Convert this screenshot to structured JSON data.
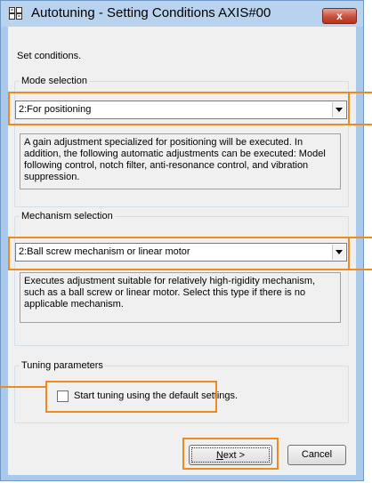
{
  "window": {
    "title": "Autotuning - Setting Conditions AXIS#00",
    "close_label": "x"
  },
  "instruction": "Set conditions.",
  "mode": {
    "legend": "Mode selection",
    "selected": "2:For positioning",
    "description": "A gain adjustment specialized for positioning will be executed. In addition, the following automatic adjustments can be executed: Model following control, notch filter, anti-resonance control, and vibration suppression."
  },
  "mechanism": {
    "legend": "Mechanism selection",
    "selected": "2:Ball screw mechanism or linear motor",
    "description": "Executes adjustment suitable for relatively high-rigidity mechanism, such as a ball screw or linear motor. Select this type if there is no applicable mechanism."
  },
  "tuning": {
    "legend": "Tuning parameters",
    "checkbox_label": "Start tuning using the default settings.",
    "checked": false
  },
  "buttons": {
    "next_prefix": "N",
    "next_rest": "ext >",
    "cancel": "Cancel"
  },
  "colors": {
    "highlight": "#ee8a1f",
    "window_frame": "#a9c8ea",
    "close_button": "#c7503c"
  },
  "icons": {
    "app": "axis-grid-icon",
    "close": "close-icon",
    "dropdown": "chevron-down-icon"
  }
}
